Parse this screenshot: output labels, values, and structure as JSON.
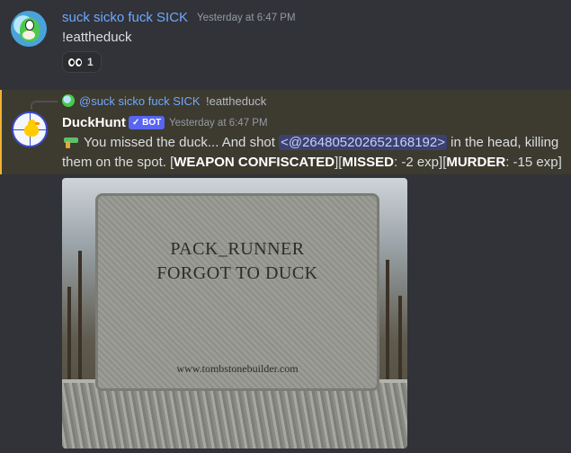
{
  "message1": {
    "author": "suck sicko fuck SICK",
    "timestamp": "Yesterday at 6:47 PM",
    "content": "!eattheduck",
    "reaction": {
      "emoji_icon": "eyes-icon",
      "count": "1"
    }
  },
  "message2": {
    "reply": {
      "author": "@suck sicko fuck SICK",
      "content": "!eattheduck"
    },
    "author": "DuckHunt",
    "badge": "✓ BOT",
    "timestamp": "Yesterday at 6:47 PM",
    "content": {
      "part1": "You missed the duck... And shot ",
      "mention": "<@264805202652168192>",
      "part2": " in the head, killing them on the spot. [",
      "bold1": "WEAPON CONFISCATED",
      "part3": "][",
      "bold2": "MISSED",
      "part4": ": -2 exp][",
      "bold3": "MURDER",
      "part5": ": -15 exp]"
    },
    "image": {
      "line1": "PACK_RUNNER",
      "line2": "FORGOT TO DUCK",
      "url": "www.tombstonebuilder.com"
    }
  },
  "colors": {
    "background": "#313338",
    "highlight": "#3d3a30",
    "username_blue": "#6fa8ff",
    "bot_badge": "#5865f2",
    "mention_bg": "#3c4270"
  }
}
